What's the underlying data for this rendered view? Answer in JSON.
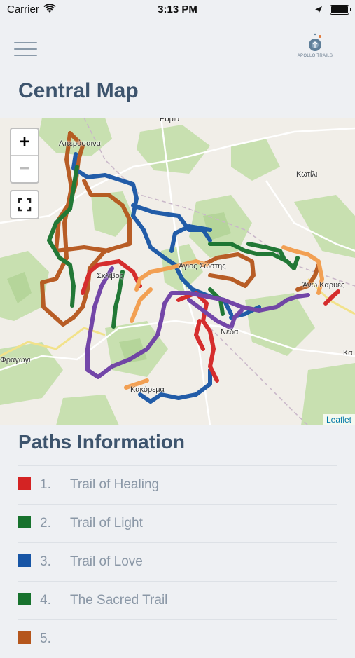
{
  "status_bar": {
    "carrier": "Carrier",
    "time": "3:13 PM"
  },
  "header": {
    "logo_text": "APOLLO TRAILS"
  },
  "page_title": "Central Map",
  "map": {
    "zoom_in": "+",
    "zoom_out": "−",
    "attribution": "Leaflet",
    "places": [
      "Ρόρια",
      "Απεράσαινα",
      "Κωτίλι",
      "Άγιος Σώστης",
      "Σκλίβος",
      "Άνω Καρυές",
      "Νέδα",
      "Κακόρεμα",
      "Φραγώγι",
      "Κα"
    ],
    "trail_colors": [
      "#d42323",
      "#17722d",
      "#1755a5",
      "#17722d",
      "#b5561c",
      "#f39c4c",
      "#6d3ea5"
    ]
  },
  "paths": {
    "title": "Paths Information",
    "items": [
      {
        "num": "1.",
        "name": "Trail of Healing",
        "color": "#d42323"
      },
      {
        "num": "2.",
        "name": "Trail of Light",
        "color": "#17722d"
      },
      {
        "num": "3.",
        "name": "Trail of Love",
        "color": "#1755a5"
      },
      {
        "num": "4.",
        "name": "The Sacred Trail",
        "color": "#17722d"
      },
      {
        "num": "5.",
        "name": "",
        "color": "#b5561c"
      }
    ]
  }
}
